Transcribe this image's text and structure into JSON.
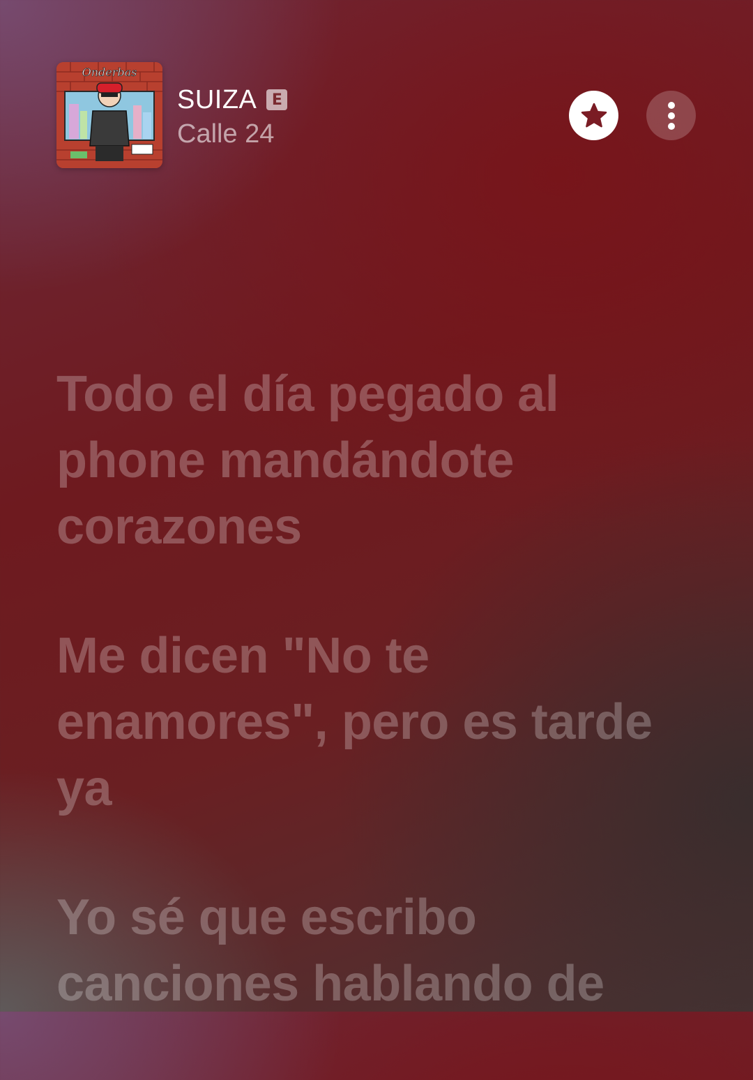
{
  "now_playing": {
    "title": "SUIZA",
    "explicit_badge": "E",
    "artist": "Calle 24",
    "album_art_text": "Onderbas"
  },
  "actions": {
    "favorite_icon": "star-icon",
    "more_icon": "ellipsis-vertical-icon"
  },
  "lyrics": [
    "Todo el día pegado al phone mandándote corazones",
    "Me dicen \"No te enamores\", pero es tarde ya",
    "Yo sé que escribo canciones hablando de"
  ],
  "colors": {
    "background_primary": "#6e1a1f",
    "lyric_text": "rgba(255,255,255,0.25)",
    "star_fill": "#7a1c24"
  }
}
